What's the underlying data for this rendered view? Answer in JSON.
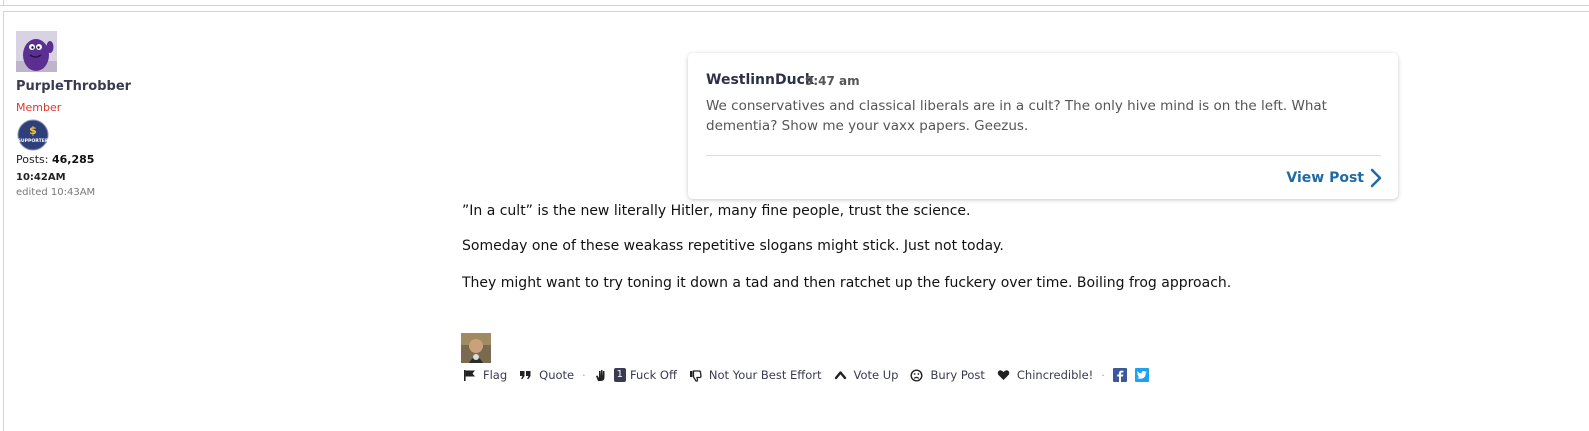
{
  "author": {
    "username": "PurpleThrobber",
    "role": "Member",
    "badge_label": "SUPPORTER",
    "posts_label": "Posts:",
    "posts_count": "46,285",
    "time": "10:42AM",
    "edited": "edited 10:43AM"
  },
  "quote": {
    "author": "WestlinnDuck",
    "time": "9:47 am",
    "body": "We conservatives and classical liberals are in a cult? The only hive mind is on the left. What dementia? Show me your vaxx papers. Geezus.",
    "view_label": "View Post"
  },
  "post": {
    "paragraphs": [
      "”In a cult” is the new literally Hitler, many fine people, trust the science.",
      "Someday one of these weakass repetitive slogans might stick. Just not today.",
      "They might want to try toning it down a tad and then ratchet up the fuckery over time. Boiling frog approach."
    ]
  },
  "actions": {
    "flag": "Flag",
    "quote": "Quote",
    "fuckoff_count": "1",
    "fuckoff": "Fuck Off",
    "not_best": "Not Your Best Effort",
    "vote_up": "Vote Up",
    "bury": "Bury Post",
    "chincredible": "Chincredible!"
  },
  "icons": {
    "flag": "flag-icon",
    "quote": "quote-icon",
    "fuckoff": "hand-wave-icon",
    "not_best": "thumbs-down-icon",
    "vote_up": "chevron-up-icon",
    "bury": "frown-icon",
    "chincredible": "heart-icon",
    "facebook": "facebook-icon",
    "twitter": "twitter-icon"
  },
  "colors": {
    "username": "#3a3a52",
    "role": "#e0342a",
    "link_blue": "#1f6aa5",
    "facebook": "#3b5998",
    "twitter": "#1da1f2"
  }
}
